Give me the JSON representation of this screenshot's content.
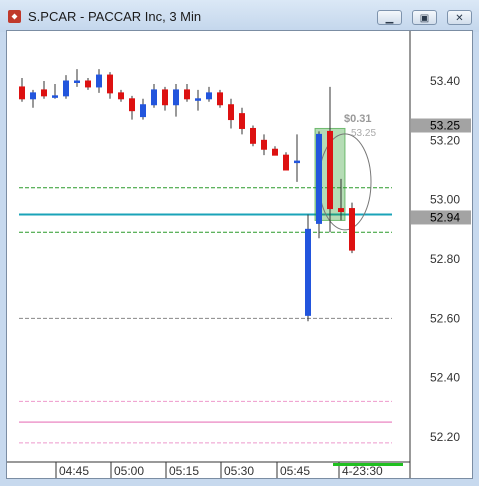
{
  "window": {
    "title": "S.PCAR - PACCAR Inc, 3 Min",
    "minimize_icon": "minimize-icon",
    "restore_icon": "restore-icon",
    "close_icon": "close-icon"
  },
  "chart_data": {
    "type": "candlestick",
    "ylim": [
      52.12,
      53.54
    ],
    "y_ticks": [
      "53.40",
      "53.20",
      "53.00",
      "52.80",
      "52.60",
      "52.40",
      "52.20"
    ],
    "x_ticks": [
      "04:45",
      "05:00",
      "05:15",
      "05:30",
      "05:45",
      "4-23:30"
    ],
    "colors": {
      "up": "#2255dd",
      "down": "#dd1111",
      "bid_ask_line": "#1aa3b8",
      "green_band": "#2a9a2a",
      "pink_lines": "#ee99cc",
      "gray_line": "#888888"
    },
    "candles": [
      {
        "o": 53.38,
        "h": 53.41,
        "l": 53.33,
        "c": 53.34
      },
      {
        "o": 53.34,
        "h": 53.37,
        "l": 53.31,
        "c": 53.36
      },
      {
        "o": 53.37,
        "h": 53.4,
        "l": 53.34,
        "c": 53.35
      },
      {
        "o": 53.35,
        "h": 53.39,
        "l": 53.34,
        "c": 53.35
      },
      {
        "o": 53.35,
        "h": 53.42,
        "l": 53.34,
        "c": 53.4
      },
      {
        "o": 53.4,
        "h": 53.44,
        "l": 53.38,
        "c": 53.4
      },
      {
        "o": 53.4,
        "h": 53.41,
        "l": 53.37,
        "c": 53.38
      },
      {
        "o": 53.38,
        "h": 53.44,
        "l": 53.36,
        "c": 53.42
      },
      {
        "o": 53.42,
        "h": 53.43,
        "l": 53.34,
        "c": 53.36
      },
      {
        "o": 53.36,
        "h": 53.37,
        "l": 53.33,
        "c": 53.34
      },
      {
        "o": 53.34,
        "h": 53.35,
        "l": 53.27,
        "c": 53.3
      },
      {
        "o": 53.28,
        "h": 53.34,
        "l": 53.27,
        "c": 53.32
      },
      {
        "o": 53.32,
        "h": 53.39,
        "l": 53.31,
        "c": 53.37
      },
      {
        "o": 53.37,
        "h": 53.38,
        "l": 53.3,
        "c": 53.32
      },
      {
        "o": 53.32,
        "h": 53.39,
        "l": 53.28,
        "c": 53.37
      },
      {
        "o": 53.37,
        "h": 53.39,
        "l": 53.33,
        "c": 53.34
      },
      {
        "o": 53.34,
        "h": 53.37,
        "l": 53.3,
        "c": 53.34
      },
      {
        "o": 53.34,
        "h": 53.38,
        "l": 53.33,
        "c": 53.36
      },
      {
        "o": 53.36,
        "h": 53.37,
        "l": 53.31,
        "c": 53.32
      },
      {
        "o": 53.32,
        "h": 53.34,
        "l": 53.24,
        "c": 53.27
      },
      {
        "o": 53.29,
        "h": 53.31,
        "l": 53.22,
        "c": 53.24
      },
      {
        "o": 53.24,
        "h": 53.25,
        "l": 53.18,
        "c": 53.19
      },
      {
        "o": 53.2,
        "h": 53.22,
        "l": 53.15,
        "c": 53.17
      },
      {
        "o": 53.17,
        "h": 53.18,
        "l": 53.15,
        "c": 53.15
      },
      {
        "o": 53.15,
        "h": 53.16,
        "l": 53.1,
        "c": 53.1
      },
      {
        "o": 53.13,
        "h": 53.22,
        "l": 53.06,
        "c": 53.13
      },
      {
        "o": 52.61,
        "h": 52.95,
        "l": 52.59,
        "c": 52.9
      },
      {
        "o": 52.92,
        "h": 53.23,
        "l": 52.87,
        "c": 53.22
      },
      {
        "o": 53.23,
        "h": 53.38,
        "l": 52.89,
        "c": 52.97
      },
      {
        "o": 52.97,
        "h": 53.07,
        "l": 52.93,
        "c": 52.96
      },
      {
        "o": 52.97,
        "h": 52.99,
        "l": 52.82,
        "c": 52.83
      }
    ],
    "price_lines": [
      {
        "name": "",
        "value": 53.04,
        "style": "dashed",
        "color": "#2a9a2a"
      },
      {
        "name": "",
        "value": 52.89,
        "style": "dashed",
        "color": "#2a9a2a"
      },
      {
        "name": "",
        "value": 52.95,
        "style": "solid",
        "color": "#1aa3b8"
      },
      {
        "name": "",
        "value": 52.6,
        "style": "dashed",
        "color": "#888888"
      },
      {
        "name": "",
        "value": 52.32,
        "style": "dashed",
        "color": "#ee99cc"
      },
      {
        "name": "",
        "value": 52.25,
        "style": "solid",
        "color": "#ee99cc"
      },
      {
        "name": "",
        "value": 52.18,
        "style": "dashed",
        "color": "#ee99cc"
      }
    ],
    "last_price_label": "53.25",
    "bid_price_label": "52.94",
    "annotations": [
      "$0.31",
      "53.25"
    ]
  }
}
